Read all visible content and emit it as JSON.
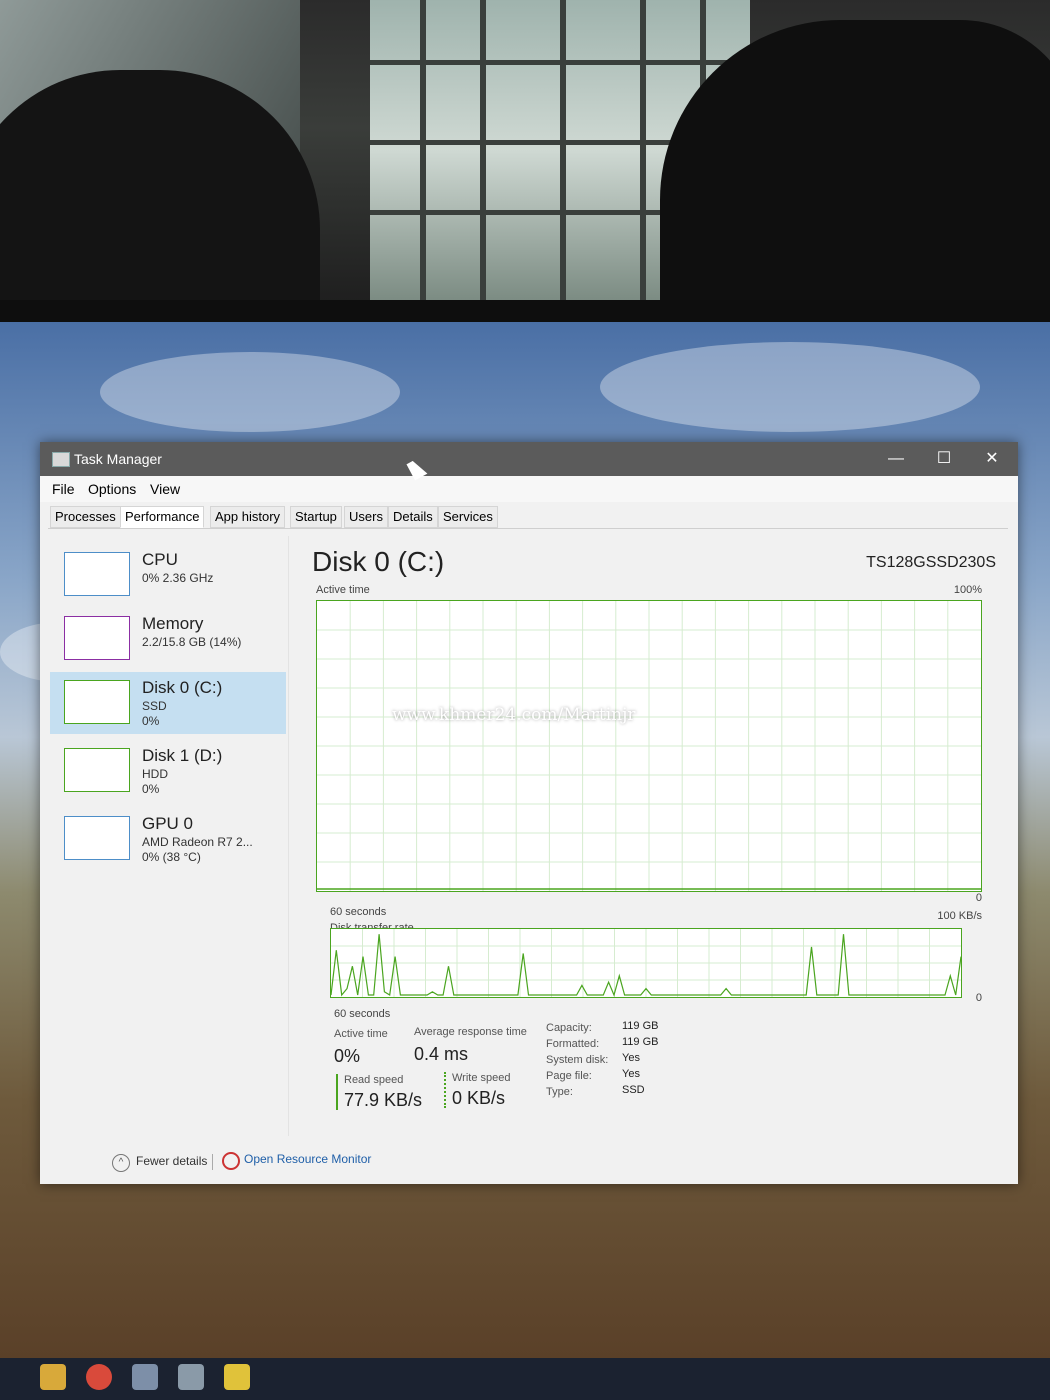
{
  "window": {
    "title": "Task Manager",
    "minimize": "—",
    "maximize": "☐",
    "close": "✕"
  },
  "menu": [
    "File",
    "Options",
    "View"
  ],
  "tabs": [
    "Processes",
    "Performance",
    "App history",
    "Startup",
    "Users",
    "Details",
    "Services"
  ],
  "active_tab": "Performance",
  "sidebar": [
    {
      "name": "CPU",
      "line1": "0% 2.36 GHz",
      "line2": ""
    },
    {
      "name": "Memory",
      "line1": "2.2/15.8 GB (14%)",
      "line2": ""
    },
    {
      "name": "Disk 0 (C:)",
      "line1": "SSD",
      "line2": "0%"
    },
    {
      "name": "Disk 1 (D:)",
      "line1": "HDD",
      "line2": "0%"
    },
    {
      "name": "GPU 0",
      "line1": "AMD Radeon R7 2...",
      "line2": "0% (38 °C)"
    }
  ],
  "main": {
    "title": "Disk 0 (C:)",
    "model": "TS128GSSD230S",
    "graph1": {
      "label": "Active time",
      "max": "100%",
      "min": "0",
      "time": "60 seconds"
    },
    "graph2": {
      "label": "Disk transfer rate",
      "max": "100 KB/s",
      "min": "0",
      "time": "60 seconds"
    },
    "stats": {
      "active_time_label": "Active time",
      "active_time": "0%",
      "avg_resp_label": "Average response time",
      "avg_resp": "0.4 ms",
      "read_label": "Read speed",
      "read": "77.9 KB/s",
      "write_label": "Write speed",
      "write": "0 KB/s"
    },
    "info": [
      {
        "label": "Capacity:",
        "value": "119 GB"
      },
      {
        "label": "Formatted:",
        "value": "119 GB"
      },
      {
        "label": "System disk:",
        "value": "Yes"
      },
      {
        "label": "Page file:",
        "value": "Yes"
      },
      {
        "label": "Type:",
        "value": "SSD"
      }
    ]
  },
  "footer": {
    "fewer": "Fewer details",
    "resource_monitor": "Open Resource Monitor"
  },
  "watermark": "www.khmer24.com/Martinjr",
  "colors": {
    "disk_green": "#4aa51f",
    "selected": "#c5dff1",
    "cpu_blue": "#4d8ec8",
    "memory_purple": "#8b2ea3"
  },
  "chart_data": {
    "type": "line",
    "title": "Disk transfer rate",
    "xlabel": "60 seconds",
    "ylabel": "",
    "ylim": [
      0,
      100
    ],
    "y_unit": "KB/s",
    "series": [
      {
        "values": [
          0,
          70,
          0,
          10,
          45,
          0,
          60,
          0,
          0,
          95,
          5,
          0,
          60,
          0,
          0,
          0,
          0,
          0,
          0,
          5,
          0,
          0,
          45,
          0,
          0,
          0,
          0,
          0,
          0,
          0,
          0,
          0,
          0,
          0,
          0,
          0,
          65,
          0,
          0,
          0,
          0,
          0,
          0,
          0,
          0,
          0,
          0,
          15,
          0,
          0,
          0,
          0,
          20,
          0,
          30,
          0,
          0,
          0,
          0,
          10,
          0,
          0,
          0,
          0,
          0,
          0,
          0,
          0,
          0,
          0,
          0,
          0,
          0,
          0,
          10,
          0,
          0,
          0,
          0,
          0,
          0,
          0,
          0,
          0,
          0,
          0,
          0,
          0,
          0,
          0,
          75,
          0,
          0,
          0,
          0,
          0,
          95,
          0,
          0,
          0,
          0,
          0,
          0,
          0,
          0,
          0,
          0,
          0,
          0,
          0,
          0,
          0,
          0,
          0,
          0,
          0,
          30,
          0,
          60
        ]
      }
    ]
  }
}
